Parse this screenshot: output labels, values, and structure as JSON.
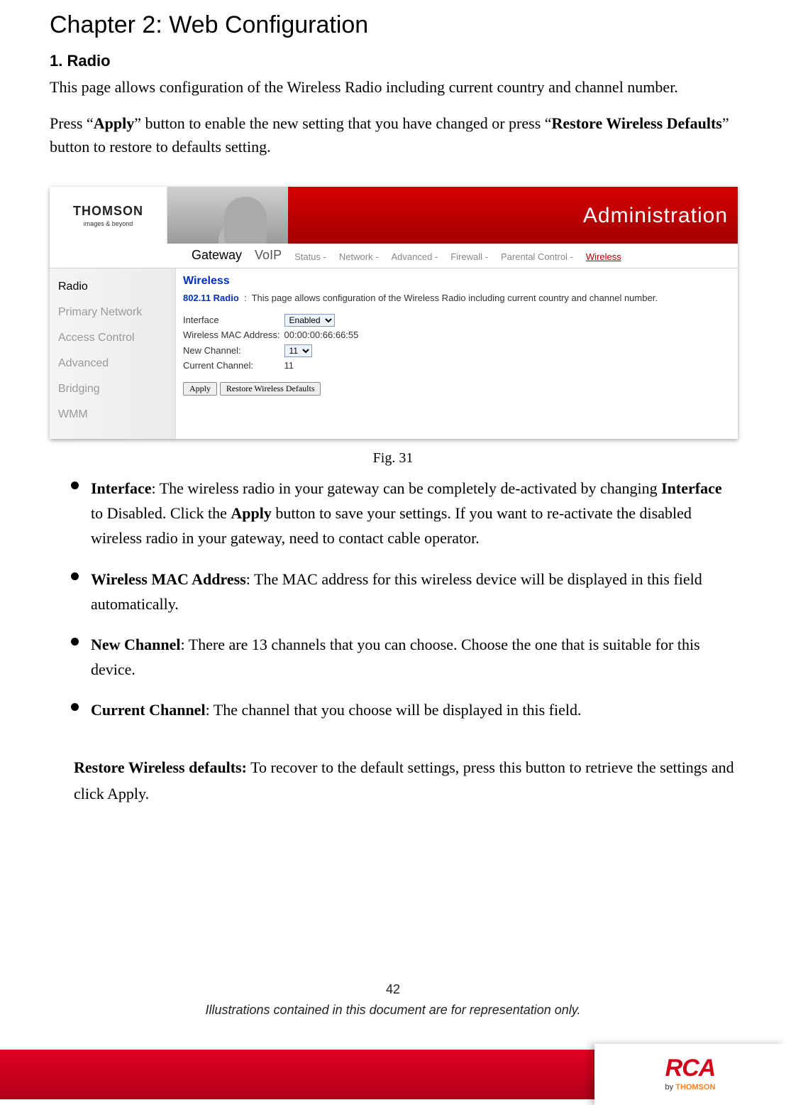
{
  "chapter_title": "Chapter 2: Web Configuration",
  "section_title": "1. Radio",
  "intro_para": "This page allows configuration of the Wireless Radio including current country and channel number.",
  "press_para_1": "Press “",
  "press_apply": "Apply",
  "press_para_2": "” button to enable the new setting that you have changed or press “",
  "press_restore": "Restore Wireless Defaults",
  "press_para_3": "” button to restore to defaults setting.",
  "screenshot": {
    "logo_name": "THOMSON",
    "logo_tagline": "images & beyond",
    "banner_title": "Administration",
    "tabs_main": [
      "Gateway",
      "VoIP"
    ],
    "tabs_sub": [
      "Status -",
      "Network -",
      "Advanced -",
      "Firewall -",
      "Parental Control -",
      "Wireless"
    ],
    "tabs_sub_active_index": 5,
    "sidebar": [
      "Radio",
      "Primary Network",
      "Access Control",
      "Advanced",
      "Bridging",
      "WMM"
    ],
    "sidebar_active_index": 0,
    "page_heading": "Wireless",
    "page_sub_label": "802.11 Radio",
    "page_sub_text": "This page allows configuration of the Wireless Radio including current country and channel number.",
    "fields": {
      "interface_label": "Interface",
      "interface_value": "Enabled",
      "mac_label": "Wireless MAC Address:",
      "mac_value": "00:00:00:66:66:55",
      "newch_label": "New Channel:",
      "newch_value": "11",
      "curch_label": "Current Channel:",
      "curch_value": "11"
    },
    "btn_apply": "Apply",
    "btn_restore": "Restore Wireless Defaults"
  },
  "fig_caption": "Fig. 31",
  "bullets": {
    "b1_label": "Interface",
    "b1_text_a": ": The wireless radio in your gateway can be completely de-activated by changing ",
    "b1_bold": "Interface",
    "b1_text_b": " to Disabled. Click the ",
    "b1_apply": "Apply",
    "b1_text_c": " button to save your settings. If you want to re-activate the disabled wireless radio in your gateway, need to contact cable operator.",
    "b2_label": "Wireless MAC Address",
    "b2_text": ": The MAC address for this wireless device will be displayed in this field automatically.",
    "b3_label": "New Channel",
    "b3_text": ": There are 13 channels that you can choose. Choose the one that is suitable for this device.",
    "b4_label": "Current Channel",
    "b4_text": ": The channel that you choose will be displayed in this field."
  },
  "restore_label": "Restore Wireless defaults:",
  "restore_text": " To recover to the default settings, press this button to retrieve the settings and click Apply.",
  "page_number": "42",
  "disclaimer": "Illustrations contained in this document are for representation only.",
  "footer_logo": "RCA",
  "footer_by_prefix": "by ",
  "footer_by_brand": "THOMSON"
}
